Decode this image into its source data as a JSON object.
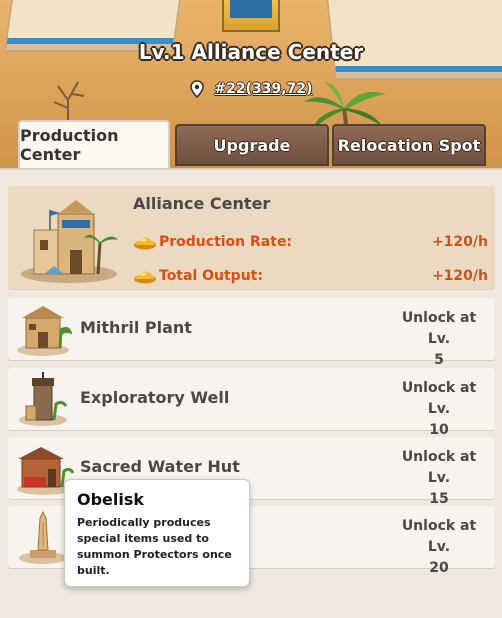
{
  "header": {
    "title": "Lv.1 Alliance Center",
    "coordinates": "#22(339,72)"
  },
  "tabs": [
    {
      "label": "Production Center",
      "active": true
    },
    {
      "label": "Upgrade",
      "active": false
    },
    {
      "label": "Relocation Spot",
      "active": false
    }
  ],
  "main_building": {
    "name": "Alliance Center",
    "stats": [
      {
        "label": "Production Rate:",
        "value": "+120/h"
      },
      {
        "label": "Total Output:",
        "value": "+120/h"
      }
    ]
  },
  "buildings": [
    {
      "name": "Mithril Plant",
      "unlock_label": "Unlock at Lv.",
      "unlock_level": "5"
    },
    {
      "name": "Exploratory Well",
      "unlock_label": "Unlock at Lv.",
      "unlock_level": "10"
    },
    {
      "name": "Sacred Water Hut",
      "unlock_label": "Unlock at Lv.",
      "unlock_level": "15"
    },
    {
      "name": "Obelisk",
      "unlock_label": "Unlock at Lv.",
      "unlock_level": "20"
    }
  ],
  "tooltip": {
    "title": "Obelisk",
    "body": "Periodically produces special items used to summon Protectors once built."
  },
  "colors": {
    "accent_orange": "#d94f11",
    "value_orange": "#c0581e",
    "highlight_card": "#ecd9c2",
    "tab_inactive": "#7a5848"
  }
}
